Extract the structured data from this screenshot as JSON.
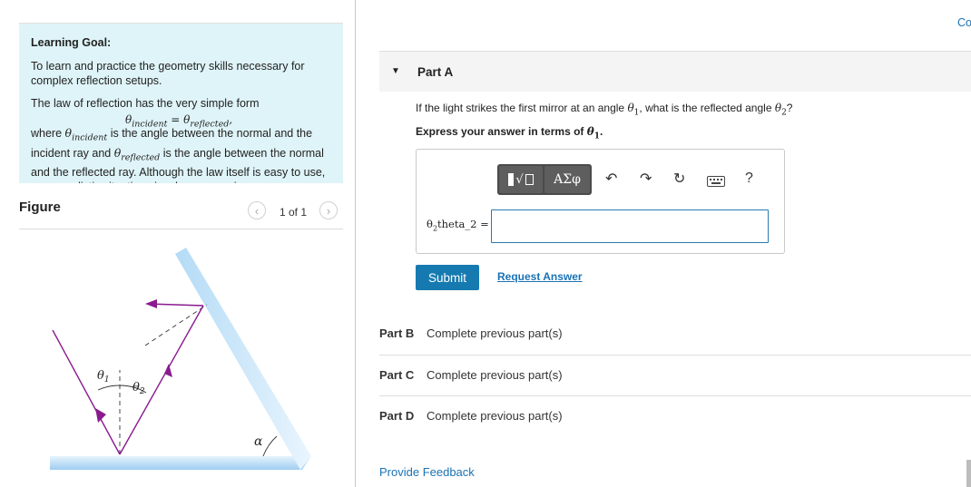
{
  "learning_goal": {
    "heading": "Learning Goal:",
    "para1": "To learn and practice the geometry skills necessary for complex reflection setups.",
    "para2": "The law of reflection has the very simple form",
    "formula": {
      "theta": "θ",
      "sub_incident": "incident",
      "equals": " = ",
      "sub_reflected": "reflected",
      "trail": ","
    },
    "para3": {
      "where": "where ",
      "theta": "θ",
      "sub_incident": "incident",
      "mid1": " is the angle between the normal and the incident ray and ",
      "sub_reflected": "reflected",
      "rest": " is the angle between the normal and the reflected ray. Although the law itself is easy to use, many realistic situations involve successive"
    }
  },
  "figure": {
    "title": "Figure",
    "pager": "1 of 1",
    "prev_glyph": "‹",
    "next_glyph": "›",
    "labels": {
      "theta1": "θ",
      "theta1_sub": "1",
      "theta2": "θ",
      "theta2_sub": "2",
      "alpha": "α"
    },
    "colors": {
      "mirror": "#aed6f5",
      "ray": "#8a1a8e"
    }
  },
  "header": {
    "co_link": "Co"
  },
  "part_a": {
    "caret": "▼",
    "title": "Part A",
    "question": {
      "pre": "If the light strikes the first mirror at an angle ",
      "t1": "θ",
      "t1_sub": "1",
      "mid": ", what is the reflected angle ",
      "t2": "θ",
      "t2_sub": "2",
      "end": "?"
    },
    "express": {
      "pre": "Express your answer in terms of ",
      "t1": "θ",
      "t1_sub": "1",
      "end": "."
    },
    "toolbar": {
      "templates_radical": "√",
      "symbols": "ΑΣφ",
      "undo": "↶",
      "redo": "↷",
      "reset": "↻",
      "help": "?"
    },
    "answer": {
      "label_theta": "θ",
      "label_sub": "2",
      "label_text": "theta_2 =",
      "value": ""
    },
    "submit_label": "Submit",
    "request_label": "Request Answer"
  },
  "other_parts": [
    {
      "label": "Part B",
      "status": "Complete previous part(s)"
    },
    {
      "label": "Part C",
      "status": "Complete previous part(s)"
    },
    {
      "label": "Part D",
      "status": "Complete previous part(s)"
    }
  ],
  "footer": {
    "feedback_link": "Provide Feedback"
  }
}
